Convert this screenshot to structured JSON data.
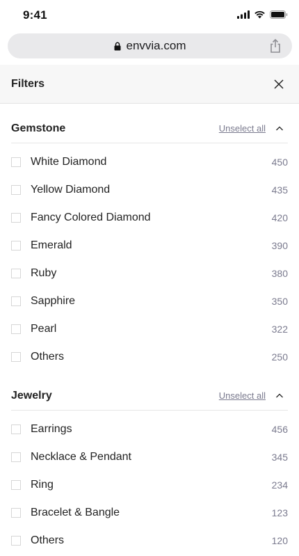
{
  "status_bar": {
    "time": "9:41",
    "icons": [
      "signal-icon",
      "wifi-icon",
      "battery-icon"
    ]
  },
  "browser": {
    "url": "envvia.com",
    "lock_icon": "lock-icon",
    "share_icon": "share-icon"
  },
  "filters": {
    "title": "Filters",
    "close_icon": "close-icon"
  },
  "sections": {
    "gemstone": {
      "title": "Gemstone",
      "unselect_label": "Unselect all",
      "options": [
        {
          "label": "White Diamond",
          "count": "450"
        },
        {
          "label": "Yellow Diamond",
          "count": "435"
        },
        {
          "label": "Fancy Colored Diamond",
          "count": "420"
        },
        {
          "label": "Emerald",
          "count": "390"
        },
        {
          "label": "Ruby",
          "count": "380"
        },
        {
          "label": "Sapphire",
          "count": "350"
        },
        {
          "label": "Pearl",
          "count": "322"
        },
        {
          "label": "Others",
          "count": "250"
        }
      ]
    },
    "jewelry": {
      "title": "Jewelry",
      "unselect_label": "Unselect all",
      "options": [
        {
          "label": "Earrings",
          "count": "456"
        },
        {
          "label": "Necklace & Pendant",
          "count": "345"
        },
        {
          "label": "Ring",
          "count": "234"
        },
        {
          "label": "Bracelet & Bangle",
          "count": "123"
        },
        {
          "label": "Others",
          "count": "120"
        }
      ]
    }
  },
  "colors": {
    "accent_muted": "#7a7a8e",
    "header_bg": "#f7f7f7",
    "url_bar_bg": "#e9e9eb"
  }
}
